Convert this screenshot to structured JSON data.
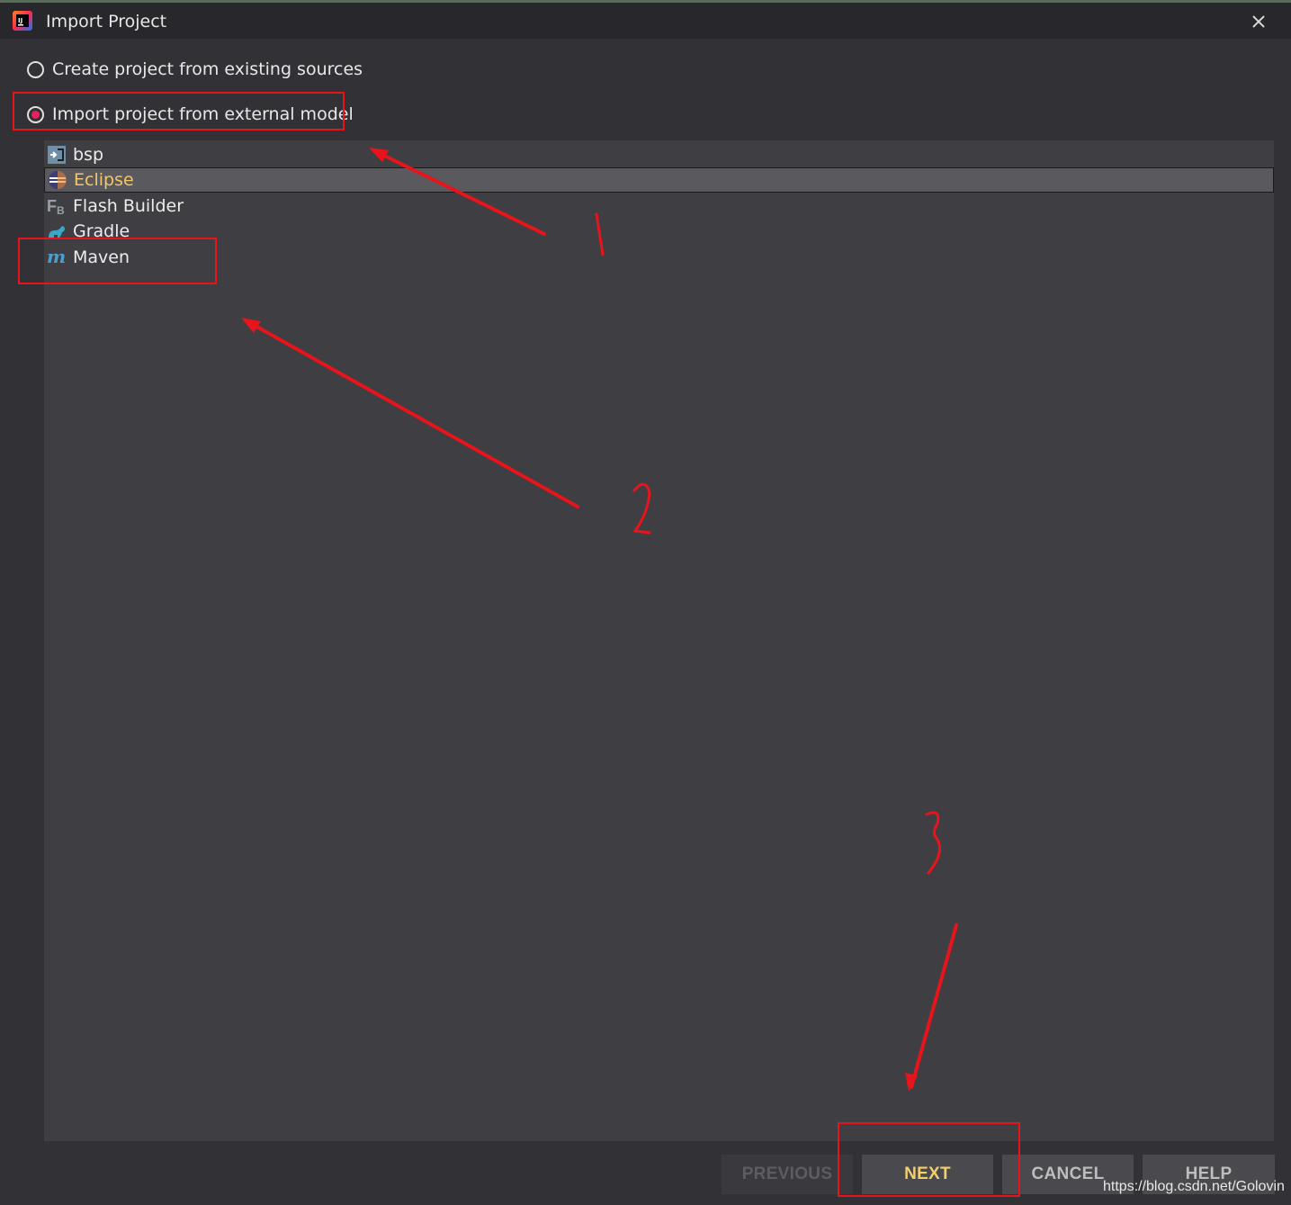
{
  "window": {
    "title": "Import Project",
    "app_icon": "intellij-idea-icon",
    "close_icon": "close-icon"
  },
  "options": [
    {
      "label": "Create project from existing sources",
      "checked": false
    },
    {
      "label": "Import project from external model",
      "checked": true
    }
  ],
  "models": [
    {
      "label": "bsp",
      "icon": "bsp-icon",
      "selected": false
    },
    {
      "label": "Eclipse",
      "icon": "eclipse-icon",
      "selected": true
    },
    {
      "label": "Flash Builder",
      "icon": "flash-builder-icon",
      "selected": false
    },
    {
      "label": "Gradle",
      "icon": "gradle-icon",
      "selected": false
    },
    {
      "label": "Maven",
      "icon": "maven-icon",
      "selected": false
    }
  ],
  "buttons": {
    "previous": "PREVIOUS",
    "next": "NEXT",
    "cancel": "CANCEL",
    "help": "HELP"
  },
  "annotations": {
    "step1": "1",
    "step2": "2",
    "step3": "3"
  },
  "watermark": "https://blog.csdn.net/Golovin",
  "colors": {
    "accent_radio": "#ea1f5d",
    "selected_text": "#f5c56b",
    "annotation_red": "#e8141c"
  }
}
